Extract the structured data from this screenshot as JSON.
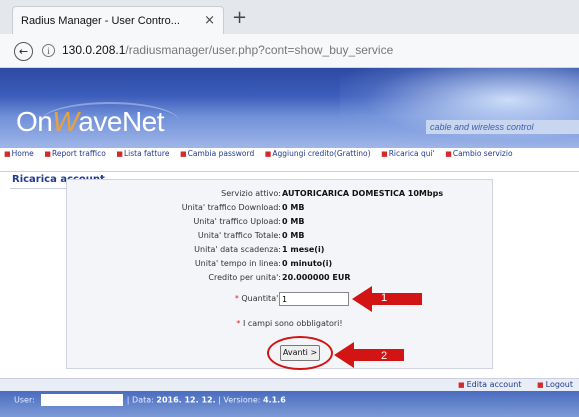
{
  "browser": {
    "tab_title": "Radius Manager - User Contro...",
    "tab_close": "×",
    "new_tab": "+",
    "back": "←",
    "info": "i",
    "url_host": "130.0.208.1",
    "url_path": "/radiusmanager/user.php?cont=show_buy_service"
  },
  "banner": {
    "logo_pre": "On",
    "logo_w": "W",
    "logo_post": "aveNet",
    "tagline": "cable and wireless control"
  },
  "menu": {
    "items": [
      "Home",
      "Report traffico",
      "Lista fatture",
      "Cambia password",
      "Aggiungi credito(Grattino)",
      "Ricarica qui'",
      "Cambio servizio"
    ]
  },
  "section_title": "Ricarica account",
  "form": {
    "rows": [
      {
        "label": "Servizio attivo:",
        "value": "AUTORICARICA DOMESTICA 10Mbps"
      },
      {
        "label": "Unita' traffico Download:",
        "value": "0 MB"
      },
      {
        "label": "Unita' traffico Upload:",
        "value": "0 MB"
      },
      {
        "label": "Unita' traffico Totale:",
        "value": "0 MB"
      },
      {
        "label": "Unita' data scadenza:",
        "value": "1 mese(i)"
      },
      {
        "label": "Unita' tempo in linea:",
        "value": "0 minuto(i)"
      },
      {
        "label": "Credito per unita':",
        "value": "20.000000 EUR"
      }
    ],
    "quantity_asterisk": "*",
    "quantity_label": "Quantita':",
    "quantity_value": "1",
    "required_asterisk": "*",
    "required_note": "I campi sono obbligatori!",
    "submit_label": "Avanti >"
  },
  "annotations": {
    "arrow1_number": "1",
    "arrow2_number": "2",
    "color": "#d21414"
  },
  "footer": {
    "edit_account": "Edita account",
    "logout": "Logout",
    "user_label": "User:",
    "data_label": "Data:",
    "data_value": "2016. 12. 12.",
    "separator": "|",
    "version_label": "Versione:",
    "version_value": "4.1.6"
  }
}
